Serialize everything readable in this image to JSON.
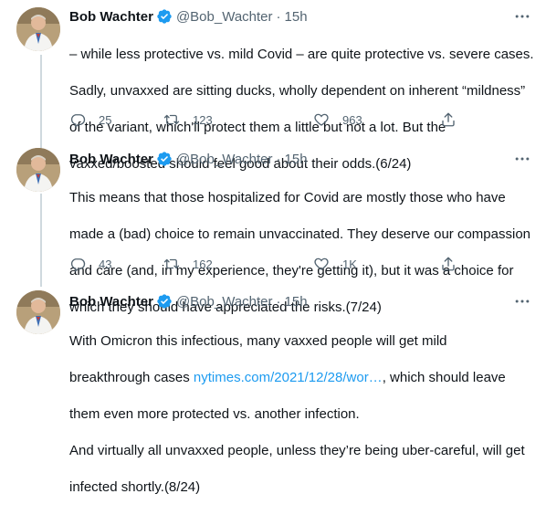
{
  "tweets": [
    {
      "name": "Bob Wachter",
      "handle": "@Bob_Wachter",
      "dot": "·",
      "time": "15h",
      "text_lines": [
        "– while less protective vs. mild Covid – are quite protective vs. severe cases.",
        "Sadly, unvaxxed are sitting ducks, wholly dependent on inherent “mildness”",
        "of the variant, which'll protect them a little but not a lot. But the",
        "vaxxed/boosted should feel good about their odds.(6/24)"
      ],
      "replies": "25",
      "retweets": "123",
      "likes": "963"
    },
    {
      "name": "Bob Wachter",
      "handle": "@Bob_Wachter",
      "dot": "·",
      "time": "15h",
      "text_lines": [
        "This means that those hospitalized for Covid are mostly those who have",
        "made a (bad) choice to remain unvaccinated. They deserve our compassion",
        "and care (and, in my experience, they're getting it), but it was a choice for",
        "which they should have appreciated the risks.(7/24)"
      ],
      "replies": "43",
      "retweets": "162",
      "likes": "1K"
    },
    {
      "name": "Bob Wachter",
      "handle": "@Bob_Wachter",
      "dot": "·",
      "time": "15h",
      "text_line1": "With Omicron this infectious, many vaxxed people will get mild",
      "text_line2_pre": "breakthrough cases ",
      "link": "nytimes.com/2021/12/28/wor…",
      "text_line2_post": ", which should leave",
      "text_line3": "them even more protected vs. another infection.",
      "text_line4": "And virtually all unvaxxed people, unless they’re being uber-careful, will get",
      "text_line5": "infected shortly.(8/24)"
    }
  ],
  "colors": {
    "verified": "#1d9bf0",
    "link": "#1d9bf0",
    "meta": "#536471"
  },
  "icons": [
    "verified-badge-icon",
    "more-icon",
    "reply-icon",
    "retweet-icon",
    "like-icon",
    "share-icon"
  ]
}
